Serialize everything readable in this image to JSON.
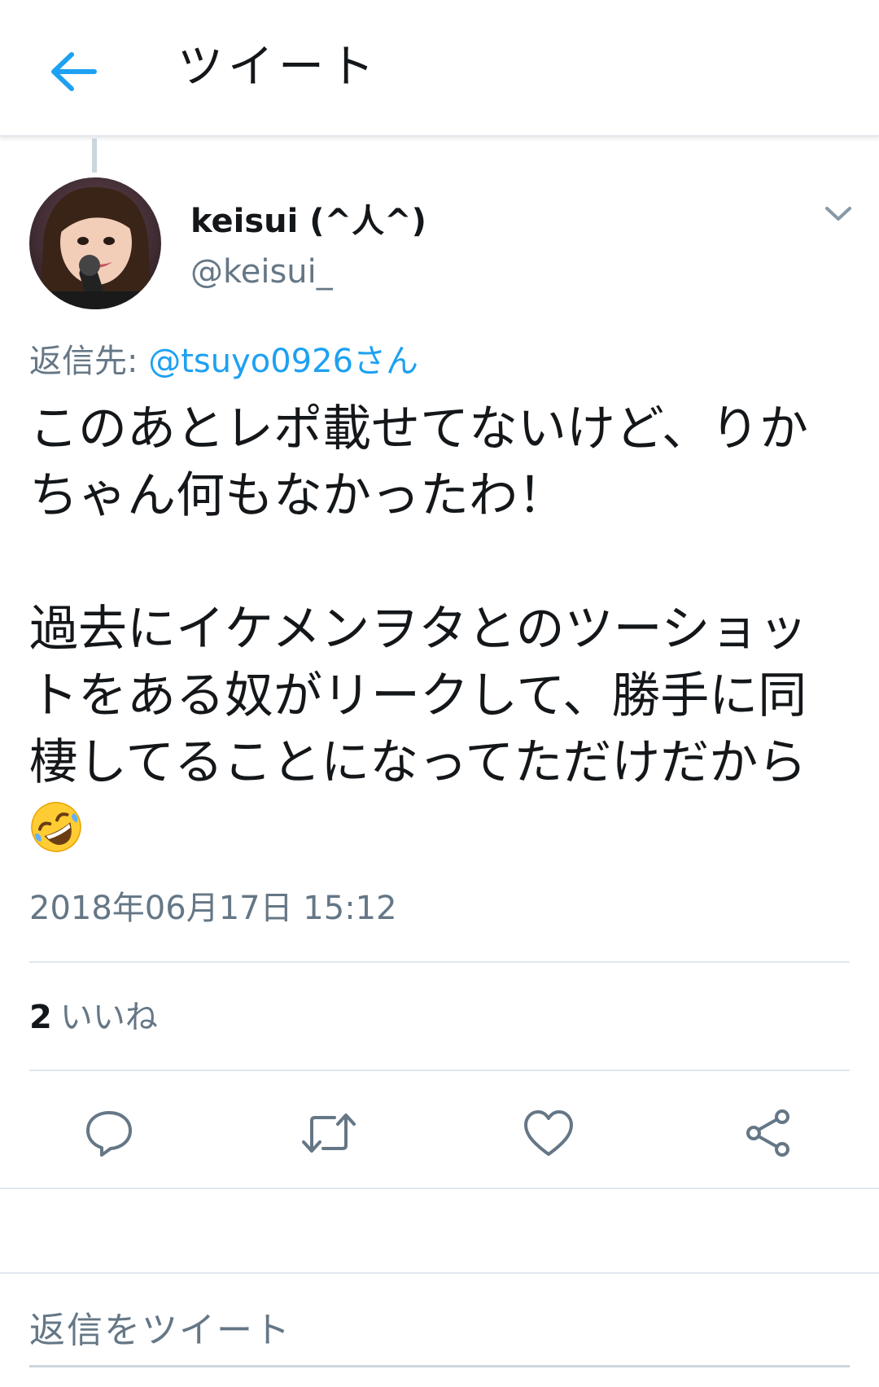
{
  "header": {
    "title": "ツイート",
    "back_icon": "arrow-left-icon",
    "accent": "#1da1f2"
  },
  "tweet": {
    "display_name": "keisui (^人^)",
    "handle": "@keisui_",
    "reply_prefix": "返信先: ",
    "reply_mention": "@tsuyo0926さん",
    "text": "このあとレポ載せてないけど、りかちゃん何もなかったわ！\n\n過去にイケメンヲタとのツーショットをある奴がリークして、勝手に同棲してることになってただけだから",
    "emoji": "rolling-on-floor-laughing",
    "timestamp": "2018年06月17日 15:12"
  },
  "stats": {
    "likes_count": "2",
    "likes_label": "いいね"
  },
  "actions": {
    "reply_icon": "reply-icon",
    "retweet_icon": "retweet-icon",
    "like_icon": "heart-icon",
    "share_icon": "share-icon"
  },
  "composer": {
    "placeholder": "返信をツイート"
  }
}
